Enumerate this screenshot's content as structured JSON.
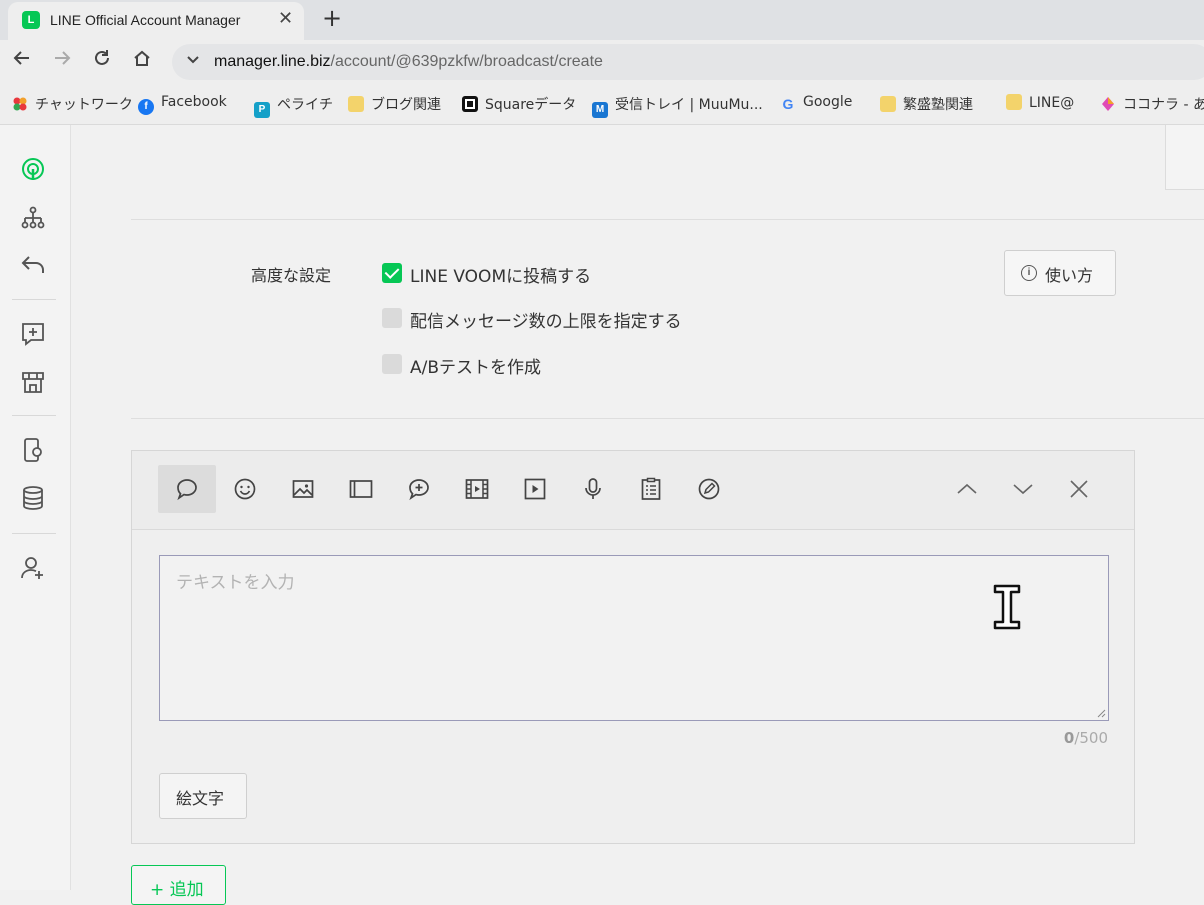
{
  "browser": {
    "tab_title": "LINE Official Account Manager",
    "favicon_letter": "L",
    "tab_close": "✕",
    "new_tab": "+",
    "url_host": "manager.line.biz",
    "url_path": "/account/@639pzkfw/broadcast/create",
    "bookmarks": [
      {
        "label": "チャットワーク",
        "icon_color": "#e8383d"
      },
      {
        "label": "Facebook",
        "icon_color": "#1877f2",
        "letter": "f"
      },
      {
        "label": "ペライチ",
        "icon_color": "#14a0c8",
        "letter": "P"
      },
      {
        "label": "ブログ関連",
        "icon_color": "#f3d36b"
      },
      {
        "label": "Squareデータ",
        "icon_color": "#111111"
      },
      {
        "label": "受信トレイ | MuuMu...",
        "icon_color": "#1976d2",
        "letter": "M"
      },
      {
        "label": "Google",
        "icon_color": "#4285f4",
        "letter": "G"
      },
      {
        "label": "繁盛塾関連",
        "icon_color": "#f3d36b"
      },
      {
        "label": "LINE@",
        "icon_color": "#f3d36b"
      },
      {
        "label": "ココナラ - あな",
        "icon_color": "#e04bb5"
      }
    ]
  },
  "settings": {
    "label": "高度な設定",
    "help_label": "使い方",
    "options": [
      {
        "label": "LINE VOOMに投稿する",
        "checked": true
      },
      {
        "label": "配信メッセージ数の上限を指定する",
        "checked": false
      },
      {
        "label": "A/Bテストを作成",
        "checked": false
      }
    ]
  },
  "editor": {
    "placeholder": "テキストを入力",
    "count": "0",
    "limit": "/500",
    "emoji_label": "絵文字",
    "toolbar": [
      "text-bubble-icon",
      "emoji-icon",
      "image-icon",
      "card-icon",
      "add-bubble-icon",
      "video-frame-icon",
      "play-icon",
      "mic-icon",
      "clipboard-icon",
      "edit-icon"
    ]
  },
  "add_label": "+ 追加",
  "colors": {
    "accent": "#06c755"
  }
}
